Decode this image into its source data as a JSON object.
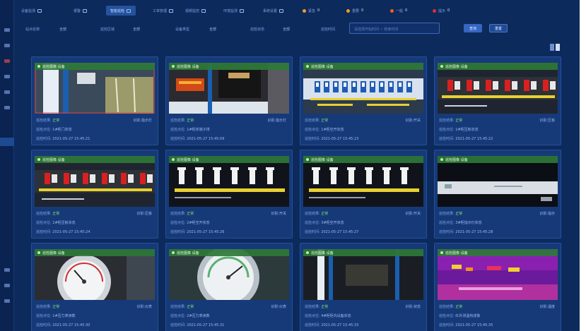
{
  "topbar": {
    "items": [
      {
        "label": "设备监测",
        "icon": "monitor-icon"
      },
      {
        "label": "报警",
        "icon": "alarm-icon"
      },
      {
        "label": "智能巡检",
        "icon": "inspect-icon",
        "active": true
      },
      {
        "label": "工单管理",
        "icon": "order-icon"
      },
      {
        "label": "视频监控",
        "icon": "camera-icon"
      },
      {
        "label": "环境监测",
        "icon": "env-icon"
      },
      {
        "label": "系统设置",
        "icon": "settings-icon"
      }
    ],
    "alerts": [
      {
        "label": "紧急",
        "value": "0",
        "color": "#f0a020"
      },
      {
        "label": "重要",
        "value": "0",
        "color": "#f0a020"
      },
      {
        "label": "一般",
        "value": "0",
        "color": "#f06020"
      },
      {
        "label": "提示",
        "value": "0",
        "color": "#e03030"
      }
    ]
  },
  "filters": {
    "site_label": "站点名称",
    "site_value": "全部",
    "area_label": "巡检区域",
    "area_value": "全部",
    "device_label": "设备类型",
    "device_value": "全部",
    "status_label": "巡检状态",
    "status_value": "全部",
    "time_label": "巡检时间",
    "time_placeholder": "请选择开始时间 ~ 结束时间",
    "search_label": "查询",
    "reset_label": "重置"
  },
  "colors": {
    "background": "#0d2a5c",
    "card": "#163a78",
    "label_bar": "#2e7838",
    "ok": "#7fe07f"
  },
  "meta_labels": {
    "status_key": "巡检结果:",
    "point_key": "巡检点位:",
    "time_key": "巡检时间:"
  },
  "cards": [
    {
      "tag": "巡检图像 设备",
      "status": "正常",
      "right": "识别:指示灯",
      "point": "1#柜门状态",
      "time": "2021-05-27 15:45:21",
      "scene": "cabinet"
    },
    {
      "tag": "巡检图像 设备",
      "status": "正常",
      "right": "识别:指示灯",
      "point": "1#柜体端子排",
      "time": "2021-05-27 15:45:09",
      "scene": "terminal"
    },
    {
      "tag": "巡检图像 设备",
      "status": "正常",
      "right": "识别:开关",
      "point": "1#柜空开状态",
      "time": "2021-05-27 15:45:23",
      "scene": "breakers-white"
    },
    {
      "tag": "巡检图像 设备",
      "status": "正常",
      "right": "识别:压板",
      "point": "1#柜压板状态",
      "time": "2021-05-27 15:45:22",
      "scene": "breakers-red"
    },
    {
      "tag": "巡检图像 设备",
      "status": "正常",
      "right": "识别:压板",
      "point": "2#柜压板状态",
      "time": "2021-05-27 15:45:24",
      "scene": "breakers-red"
    },
    {
      "tag": "巡检图像 设备",
      "status": "正常",
      "right": "识别:开关",
      "point": "2#柜空开状态",
      "time": "2021-05-27 15:45:26",
      "scene": "switches-white"
    },
    {
      "tag": "巡检图像 设备",
      "status": "正常",
      "right": "识别:开关",
      "point": "3#柜空开状态",
      "time": "2021-05-27 15:45:27",
      "scene": "switches-white"
    },
    {
      "tag": "巡检图像 设备",
      "status": "正常",
      "right": "识别:指示",
      "point": "3#柜指示灯状态",
      "time": "2021-05-27 15:45:28",
      "scene": "panel-white"
    },
    {
      "tag": "巡检图像 设备",
      "status": "正常",
      "right": "识别:仪表",
      "point": "1#压力表读数",
      "time": "2021-05-27 15:45:30",
      "scene": "gauge-1"
    },
    {
      "tag": "巡检图像 设备",
      "status": "正常",
      "right": "识别:仪表",
      "point": "2#压力表读数",
      "time": "2021-05-27 15:45:31",
      "scene": "gauge-2"
    },
    {
      "tag": "巡检图像 设备",
      "status": "正常",
      "right": "识别:状态",
      "point": "4#柜柜内设备状态",
      "time": "2021-05-27 15:45:33",
      "scene": "cabinet-dark"
    },
    {
      "tag": "巡检图像 设备",
      "status": "正常",
      "right": "识别:温度",
      "point": "红外测温热成像",
      "time": "2021-05-27 15:45:35",
      "scene": "thermal"
    }
  ]
}
